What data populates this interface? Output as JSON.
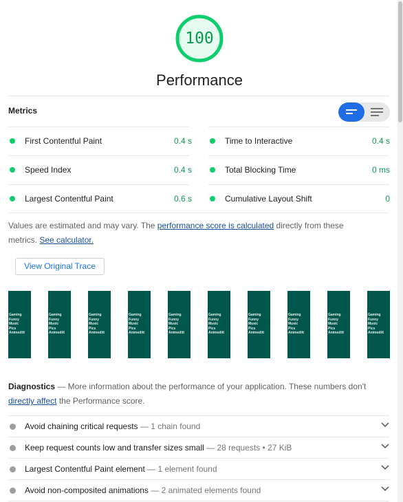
{
  "gauge": {
    "score": "100",
    "score_fraction": 1.0,
    "title": "Performance",
    "color": "#0cce6b"
  },
  "metrics": {
    "title": "Metrics",
    "items": [
      {
        "name": "First Contentful Paint",
        "value": "0.4 s"
      },
      {
        "name": "Time to Interactive",
        "value": "0.4 s"
      },
      {
        "name": "Speed Index",
        "value": "0.4 s"
      },
      {
        "name": "Total Blocking Time",
        "value": "0 ms"
      },
      {
        "name": "Largest Contentful Paint",
        "value": "0.6 s"
      },
      {
        "name": "Cumulative Layout Shift",
        "value": "0"
      }
    ]
  },
  "note": {
    "part1": "Values are estimated and may vary. The ",
    "link1": "performance score is calculated",
    "part2": " directly from these metrics. ",
    "link2": "See calculator."
  },
  "trace_button": "View Original Trace",
  "filmstrip": {
    "frame_text": "Gaming\nFunny\nMusic\nPics\nAnimeditt",
    "frame_color": "#00564a",
    "count": 10
  },
  "diagnostics": {
    "title": "Diagnostics",
    "desc_part1": " — More information about the performance of your application. These numbers don't ",
    "link": "directly affect",
    "desc_part2": " the Performance score.",
    "items": [
      {
        "title": "Avoid chaining critical requests",
        "detail": "1 chain found"
      },
      {
        "title": "Keep request counts low and transfer sizes small",
        "detail": "28 requests • 27 KiB"
      },
      {
        "title": "Largest Contentful Paint element",
        "detail": "1 element found"
      },
      {
        "title": "Avoid non-composited animations",
        "detail": "2 animated elements found"
      }
    ]
  }
}
